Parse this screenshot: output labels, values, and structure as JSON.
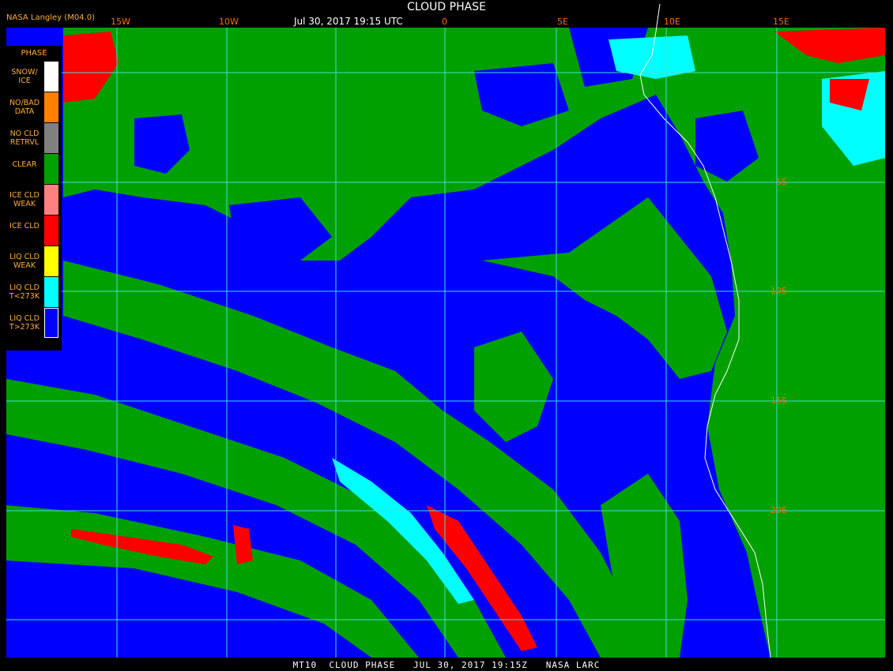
{
  "header": {
    "title": "CLOUD PHASE",
    "datetime": "Jul 30, 2017 19:15 UTC",
    "agency": "NASA Langley (M04.0)"
  },
  "footer": {
    "text": "MT10  CLOUD PHASE   JUL 30, 2017 19:15Z   NASA LARC"
  },
  "legend": {
    "title": "PHASE",
    "items": [
      {
        "label": "SNOW/\nICE",
        "color": "#ffffff"
      },
      {
        "label": "NO/BAD\nDATA",
        "color": "#ff8000"
      },
      {
        "label": "NO CLD\nRETRVL",
        "color": "#808080"
      },
      {
        "label": "CLEAR",
        "color": "#00a000"
      },
      {
        "label": "ICE CLD\nWEAK",
        "color": "#ff8080"
      },
      {
        "label": "ICE CLD",
        "color": "#ff0000"
      },
      {
        "label": "LIQ CLD\nWEAK",
        "color": "#ffff00"
      },
      {
        "label": "LIQ CLD\nT<273K",
        "color": "#00ffff"
      },
      {
        "label": "LIQ CLD\nT>273K",
        "color": "#0000ff"
      }
    ]
  },
  "grid": {
    "longitudes": [
      "15W",
      "10W",
      "0",
      "5E",
      "10E",
      "15E"
    ],
    "latitudes": [
      "5S",
      "10S",
      "15S",
      "20S"
    ],
    "line_color": "#40e0d0"
  },
  "colors": {
    "clear": "#00a000",
    "liquid_warm": "#0000ff",
    "liquid_cold": "#00ffff",
    "ice": "#ff0000",
    "coastline": "#ffffff"
  }
}
